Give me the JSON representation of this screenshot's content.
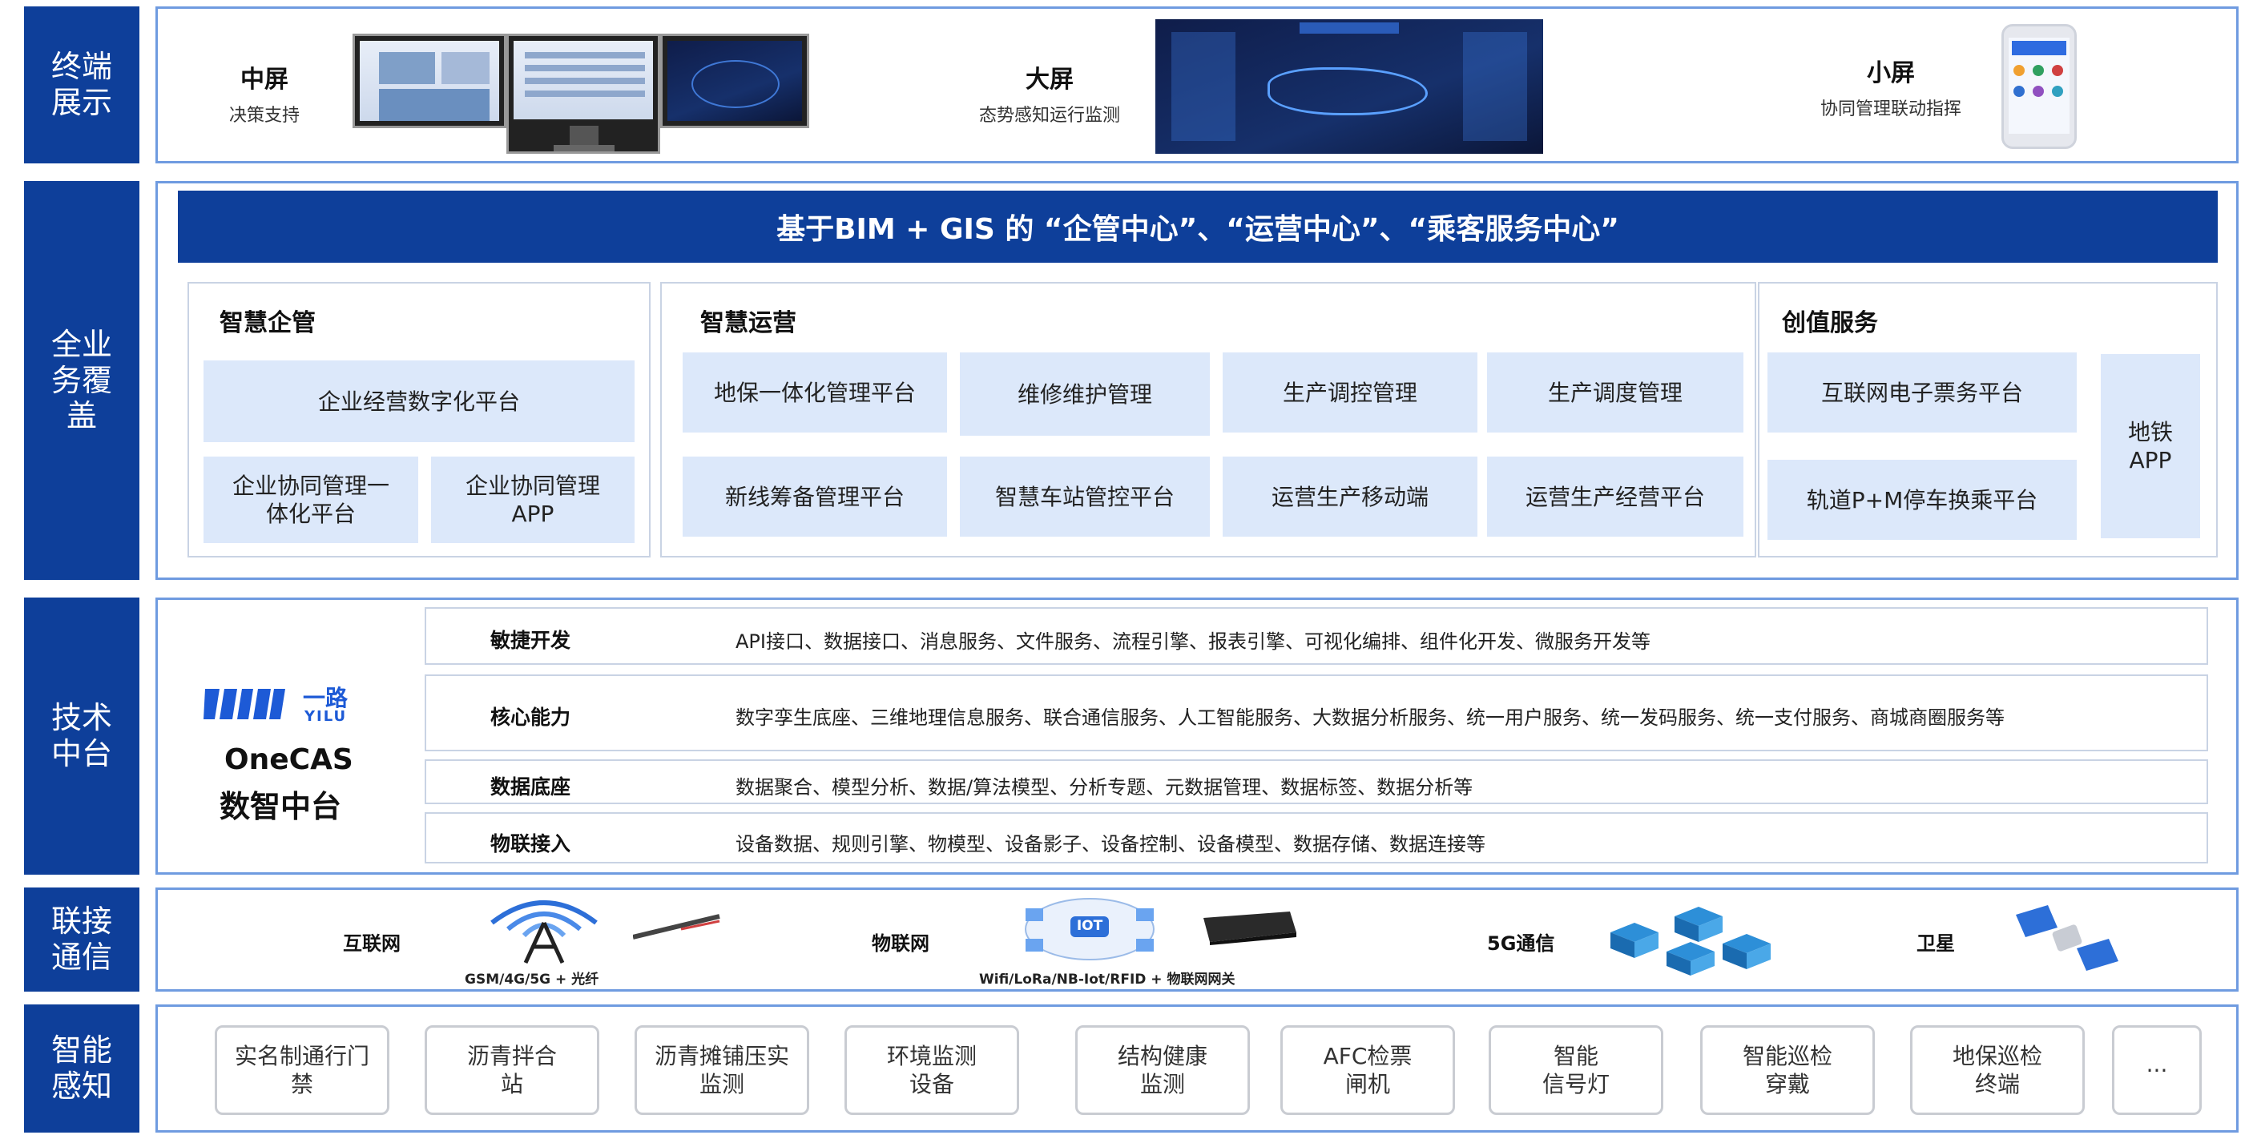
{
  "layers": [
    {
      "label": "终端\n展示"
    },
    {
      "label": "全业\n务覆\n盖"
    },
    {
      "label": "技术\n中台"
    },
    {
      "label": "联接\n通信"
    },
    {
      "label": "智能\n感知"
    }
  ],
  "terminal": {
    "mid": {
      "title": "中屏",
      "sub": "决策支持"
    },
    "big": {
      "title": "大屏",
      "sub": "态势感知运行监测"
    },
    "small": {
      "title": "小屏",
      "sub": "协同管理联动指挥"
    }
  },
  "business": {
    "banner": "基于BIM + GIS 的 “企管中心”、“运营中心”、“乘客服务中心”",
    "mgmt": {
      "title": "智慧企管",
      "items": [
        "企业经营数字化平台",
        "企业协同管理一\n体化平台",
        "企业协同管理\nAPP"
      ]
    },
    "ops": {
      "title": "智慧运营",
      "items": [
        "地保一体化管理平台",
        "维修维护管理",
        "生产调控管理",
        "生产调度管理",
        "新线筹备管理平台",
        "智慧车站管控平台",
        "运营生产移动端",
        "运营生产经营平台"
      ]
    },
    "value": {
      "title": "创值服务",
      "items": [
        "互联网电子票务平台",
        "轨道P+M停车换乘平台",
        "地铁\nAPP"
      ]
    }
  },
  "tech": {
    "logo_text": "一路",
    "logo_sub": "YILU",
    "brand": "OneCAS",
    "brand_sub": "数智中台",
    "rows": [
      {
        "name": "敏捷开发",
        "desc": "API接口、数据接口、消息服务、文件服务、流程引擎、报表引擎、可视化编排、组件化开发、微服务开发等"
      },
      {
        "name": "核心能力",
        "desc": "数字孪生底座、三维地理信息服务、联合通信服务、人工智能服务、大数据分析服务、统一用户服务、统一发码服务、统一支付服务、商城商圈服务等"
      },
      {
        "name": "数据底座",
        "desc": "数据聚合、模型分析、数据/算法模型、分析专题、元数据管理、数据标签、数据分析等"
      },
      {
        "name": "物联接入",
        "desc": "设备数据、规则引擎、物模型、设备影子、设备控制、设备模型、数据存储、数据连接等"
      }
    ]
  },
  "connect": {
    "internet": {
      "label": "互联网",
      "sub": "GSM/4G/5G + 光纤"
    },
    "iot": {
      "label": "物联网",
      "sub": "Wifi/LoRa/NB-Iot/RFID + 物联网网关",
      "icon_text": "IOT"
    },
    "g5": {
      "label": "5G通信"
    },
    "sat": {
      "label": "卫星"
    }
  },
  "perception": {
    "items": [
      "实名制通行门\n禁",
      "沥青拌合\n站",
      "沥青摊铺压实\n监测",
      "环境监测\n设备",
      "结构健康\n监测",
      "AFC检票\n闸机",
      "智能\n信号灯",
      "智能巡检\n穿戴",
      "地保巡检\n终端",
      "···"
    ]
  },
  "colors": {
    "primary": "#0e3f9a",
    "frame": "#6f9be0",
    "cell": "#dce8fa"
  }
}
